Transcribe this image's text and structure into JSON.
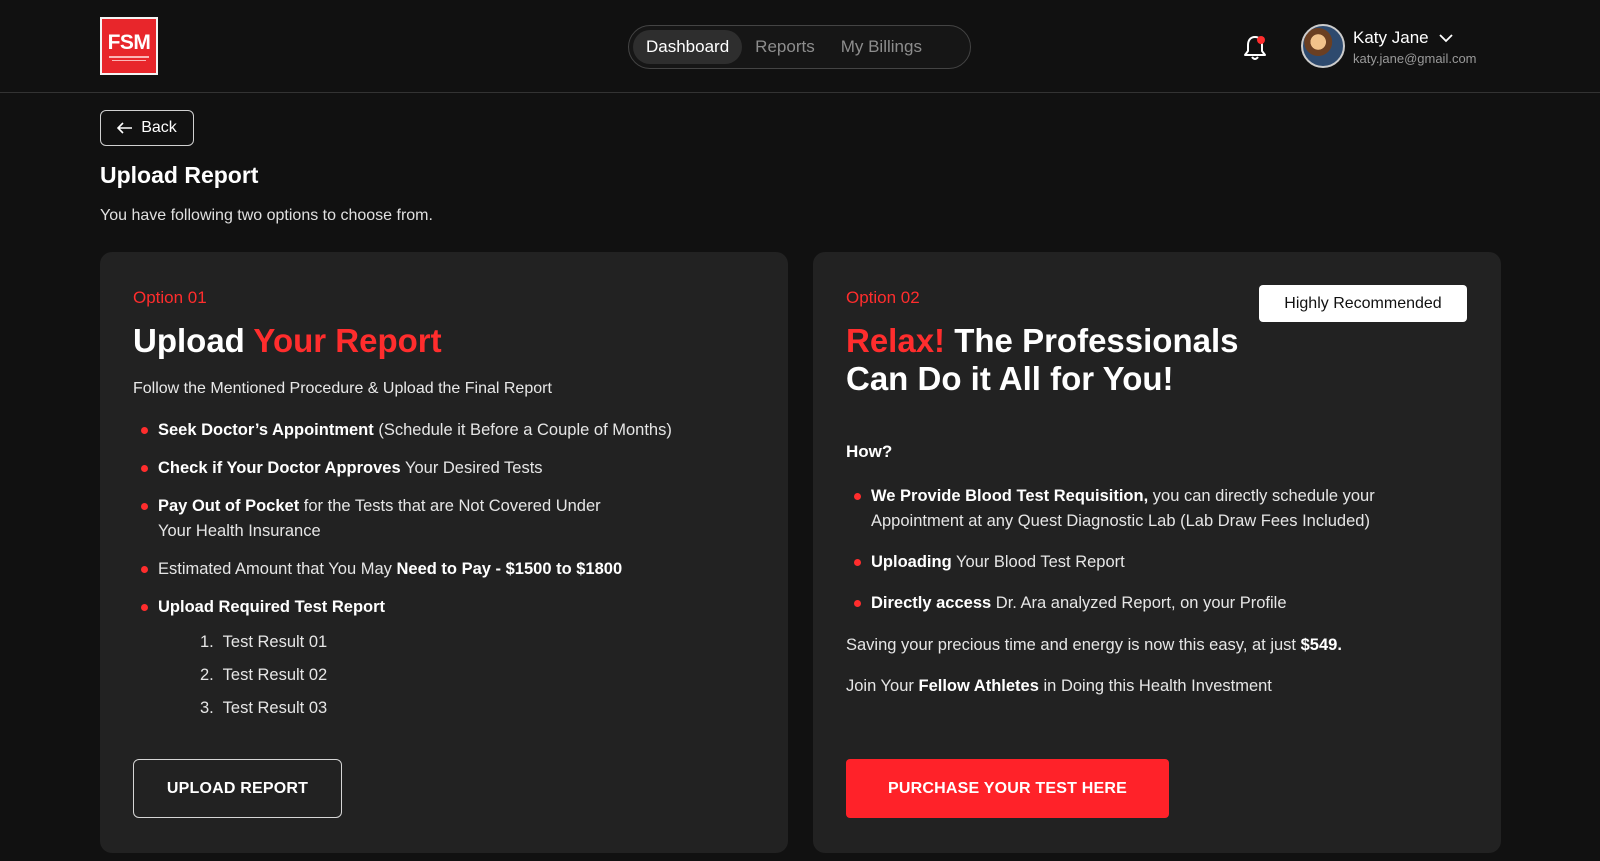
{
  "logo": {
    "text": "FSM"
  },
  "nav": {
    "tabs": [
      "Dashboard",
      "Reports",
      "My Billings"
    ],
    "active": 0
  },
  "user": {
    "name": "Katy Jane",
    "email": "katy.jane@gmail.com"
  },
  "back_label": "Back",
  "page": {
    "title": "Upload Report",
    "subtitle": "You have following two options to choose from."
  },
  "option1": {
    "label": "Option 01",
    "heading_white": "Upload",
    "heading_red": "Your Report",
    "description": "Follow the Mentioned Procedure & Upload the Final Report",
    "bullets": [
      {
        "bold": "Seek Doctor’s Appointment",
        "rest": "(Schedule it Before a Couple of Months)"
      },
      {
        "bold": "Check if Your Doctor Approves",
        "rest": "Your Desired Tests"
      },
      {
        "bold": "Pay Out of Pocket",
        "rest": "for the Tests that are Not Covered Under Your Health Insurance"
      },
      {
        "pre": "Estimated Amount that You May",
        "bold": "Need to Pay - $1500 to $1800"
      },
      {
        "bold": "Upload Required Test Report"
      }
    ],
    "test_results": [
      "Test Result 01",
      "Test Result 02",
      "Test Result 03"
    ],
    "button": "UPLOAD REPORT"
  },
  "option2": {
    "label": "Option 02",
    "badge": "Highly Recommended",
    "heading_red": "Relax!",
    "heading_white_1": "The Professionals",
    "heading_white_2": "Can Do it All for You!",
    "how": "How?",
    "bullets": [
      {
        "bold": "We Provide Blood Test Requisition,",
        "rest": "you can directly schedule your Appointment at any Quest Diagnostic Lab (Lab Draw Fees Included)"
      },
      {
        "bold": "Uploading",
        "rest": "Your Blood Test Report"
      },
      {
        "bold": "Directly access",
        "rest": "Dr. Ara analyzed Report, on your Profile"
      }
    ],
    "saving_text": "Saving your precious time and energy is now this easy, at just",
    "price": "$549.",
    "join_pre": "Join Your",
    "join_bold": "Fellow Athletes",
    "join_post": "in Doing this Health Investment",
    "button": "PURCHASE YOUR TEST HERE"
  },
  "colors": {
    "accent": "#ff2d2d",
    "background": "#111111",
    "card": "#222222"
  }
}
